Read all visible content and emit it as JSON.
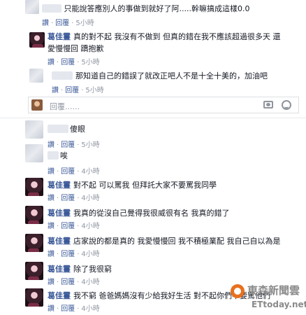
{
  "actions": {
    "like": "讚",
    "reply": "回覆",
    "dot": "·"
  },
  "comments": [
    {
      "author": "",
      "text": "只能說答應別人的事做到就好了阿.....幹嘛搞成這樣0.0",
      "time": "5小時"
    },
    {
      "author": "葛佳霻",
      "text_line1": "真的對不起 我沒有不做到 但真的錯在我不應該超過很多天 還",
      "text_line2": "愛慢慢回 蹻抱歉",
      "time": "5小時"
    },
    {
      "author": "",
      "text": "那知道自己的錯誤了就改正吧人不是十全十美的，加油吧",
      "time": "5小時"
    },
    {
      "author": "",
      "text": "傻眼",
      "time": "5小時"
    },
    {
      "author": "",
      "text": "唉",
      "time": "4小時"
    },
    {
      "author": "葛佳霻",
      "text": "對不起 可以罵我 但拜託大家不要罵我同學",
      "time": "4小時"
    },
    {
      "author": "葛佳霻",
      "text": "我真的從沒自己覺得我很威很有名 我真的錯了",
      "time": "4小時"
    },
    {
      "author": "葛佳霻",
      "text": "店家說的都是真的 我愛慢慢回 我不積極業配 我自己自以為是",
      "time": "4小時"
    },
    {
      "author": "葛佳霻",
      "text": "除了我很窮",
      "time": "4小時"
    },
    {
      "author": "葛佳霻",
      "text": "我不窮 爸爸媽媽沒有少給我好生活 對不起你們不要罵他們",
      "time": "4小時"
    }
  ],
  "reply_box": {
    "placeholder": "回覆......",
    "camera_icon": "camera-icon",
    "emoji_icon": "smiley-icon"
  },
  "watermark": {
    "brand": "東森新聞雲",
    "site": "ETtoday.net",
    "brand_color": "#e8701f"
  }
}
